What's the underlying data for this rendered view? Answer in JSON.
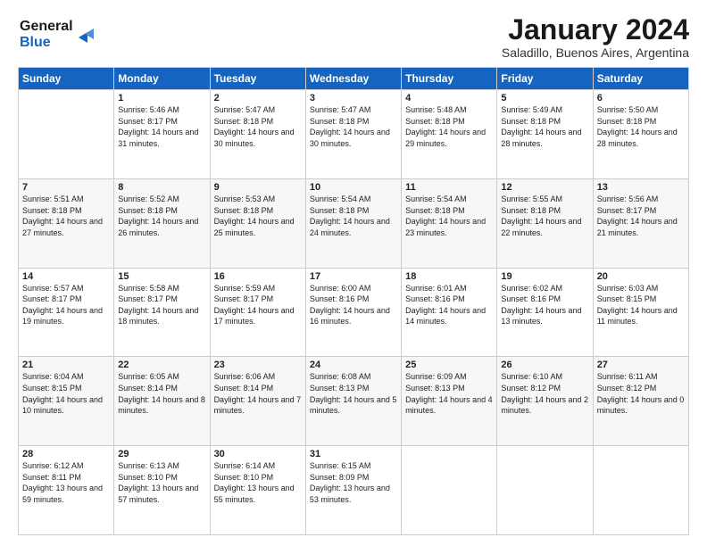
{
  "logo": {
    "line1": "General",
    "line2": "Blue"
  },
  "header": {
    "title": "January 2024",
    "subtitle": "Saladillo, Buenos Aires, Argentina"
  },
  "days_of_week": [
    "Sunday",
    "Monday",
    "Tuesday",
    "Wednesday",
    "Thursday",
    "Friday",
    "Saturday"
  ],
  "weeks": [
    [
      {
        "day": null
      },
      {
        "day": "1",
        "sunrise": "5:46 AM",
        "sunset": "8:17 PM",
        "daylight": "14 hours and 31 minutes."
      },
      {
        "day": "2",
        "sunrise": "5:47 AM",
        "sunset": "8:18 PM",
        "daylight": "14 hours and 30 minutes."
      },
      {
        "day": "3",
        "sunrise": "5:47 AM",
        "sunset": "8:18 PM",
        "daylight": "14 hours and 30 minutes."
      },
      {
        "day": "4",
        "sunrise": "5:48 AM",
        "sunset": "8:18 PM",
        "daylight": "14 hours and 29 minutes."
      },
      {
        "day": "5",
        "sunrise": "5:49 AM",
        "sunset": "8:18 PM",
        "daylight": "14 hours and 28 minutes."
      },
      {
        "day": "6",
        "sunrise": "5:50 AM",
        "sunset": "8:18 PM",
        "daylight": "14 hours and 28 minutes."
      }
    ],
    [
      {
        "day": "7",
        "sunrise": "5:51 AM",
        "sunset": "8:18 PM",
        "daylight": "14 hours and 27 minutes."
      },
      {
        "day": "8",
        "sunrise": "5:52 AM",
        "sunset": "8:18 PM",
        "daylight": "14 hours and 26 minutes."
      },
      {
        "day": "9",
        "sunrise": "5:53 AM",
        "sunset": "8:18 PM",
        "daylight": "14 hours and 25 minutes."
      },
      {
        "day": "10",
        "sunrise": "5:54 AM",
        "sunset": "8:18 PM",
        "daylight": "14 hours and 24 minutes."
      },
      {
        "day": "11",
        "sunrise": "5:54 AM",
        "sunset": "8:18 PM",
        "daylight": "14 hours and 23 minutes."
      },
      {
        "day": "12",
        "sunrise": "5:55 AM",
        "sunset": "8:18 PM",
        "daylight": "14 hours and 22 minutes."
      },
      {
        "day": "13",
        "sunrise": "5:56 AM",
        "sunset": "8:17 PM",
        "daylight": "14 hours and 21 minutes."
      }
    ],
    [
      {
        "day": "14",
        "sunrise": "5:57 AM",
        "sunset": "8:17 PM",
        "daylight": "14 hours and 19 minutes."
      },
      {
        "day": "15",
        "sunrise": "5:58 AM",
        "sunset": "8:17 PM",
        "daylight": "14 hours and 18 minutes."
      },
      {
        "day": "16",
        "sunrise": "5:59 AM",
        "sunset": "8:17 PM",
        "daylight": "14 hours and 17 minutes."
      },
      {
        "day": "17",
        "sunrise": "6:00 AM",
        "sunset": "8:16 PM",
        "daylight": "14 hours and 16 minutes."
      },
      {
        "day": "18",
        "sunrise": "6:01 AM",
        "sunset": "8:16 PM",
        "daylight": "14 hours and 14 minutes."
      },
      {
        "day": "19",
        "sunrise": "6:02 AM",
        "sunset": "8:16 PM",
        "daylight": "14 hours and 13 minutes."
      },
      {
        "day": "20",
        "sunrise": "6:03 AM",
        "sunset": "8:15 PM",
        "daylight": "14 hours and 11 minutes."
      }
    ],
    [
      {
        "day": "21",
        "sunrise": "6:04 AM",
        "sunset": "8:15 PM",
        "daylight": "14 hours and 10 minutes."
      },
      {
        "day": "22",
        "sunrise": "6:05 AM",
        "sunset": "8:14 PM",
        "daylight": "14 hours and 8 minutes."
      },
      {
        "day": "23",
        "sunrise": "6:06 AM",
        "sunset": "8:14 PM",
        "daylight": "14 hours and 7 minutes."
      },
      {
        "day": "24",
        "sunrise": "6:08 AM",
        "sunset": "8:13 PM",
        "daylight": "14 hours and 5 minutes."
      },
      {
        "day": "25",
        "sunrise": "6:09 AM",
        "sunset": "8:13 PM",
        "daylight": "14 hours and 4 minutes."
      },
      {
        "day": "26",
        "sunrise": "6:10 AM",
        "sunset": "8:12 PM",
        "daylight": "14 hours and 2 minutes."
      },
      {
        "day": "27",
        "sunrise": "6:11 AM",
        "sunset": "8:12 PM",
        "daylight": "14 hours and 0 minutes."
      }
    ],
    [
      {
        "day": "28",
        "sunrise": "6:12 AM",
        "sunset": "8:11 PM",
        "daylight": "13 hours and 59 minutes."
      },
      {
        "day": "29",
        "sunrise": "6:13 AM",
        "sunset": "8:10 PM",
        "daylight": "13 hours and 57 minutes."
      },
      {
        "day": "30",
        "sunrise": "6:14 AM",
        "sunset": "8:10 PM",
        "daylight": "13 hours and 55 minutes."
      },
      {
        "day": "31",
        "sunrise": "6:15 AM",
        "sunset": "8:09 PM",
        "daylight": "13 hours and 53 minutes."
      },
      {
        "day": null
      },
      {
        "day": null
      },
      {
        "day": null
      }
    ]
  ]
}
